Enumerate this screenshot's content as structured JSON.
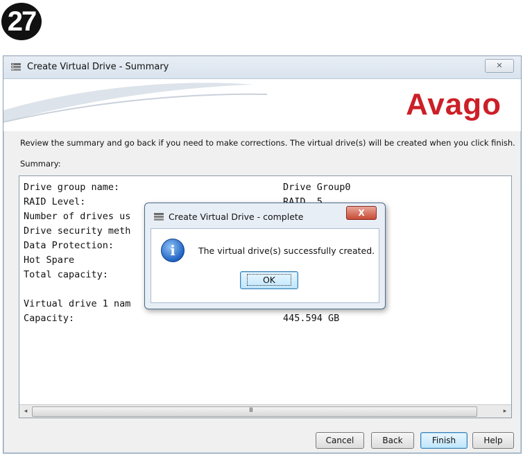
{
  "step_number": "27",
  "window": {
    "title": "Create Virtual Drive - Summary",
    "close_glyph": "✕"
  },
  "brand": {
    "logo_text": "Avago",
    "logo_color": "#cc1f27"
  },
  "instructions": "Review the summary and go back if you need to make corrections. The virtual drive(s) will be created when you click finish.",
  "summary_label": "Summary:",
  "summary_rows": [
    {
      "label": "Drive group name:",
      "value": "Drive Group0"
    },
    {
      "label": "RAID Level:",
      "value": "RAID  5"
    },
    {
      "label": "Number of drives us",
      "value": ""
    },
    {
      "label": "Drive security meth",
      "value": ""
    },
    {
      "label": "Data Protection:",
      "value": ""
    },
    {
      "label": "Hot Spare",
      "value": ""
    },
    {
      "label": "Total capacity:",
      "value": ""
    },
    {
      "label": "Virtual drive 1 nam",
      "value": ""
    },
    {
      "label": "Capacity:",
      "value": "445.594 GB"
    }
  ],
  "scrollbar": {
    "grip": "III",
    "left_arrow": "◂",
    "right_arrow": "▸"
  },
  "buttons": {
    "cancel": "Cancel",
    "back": "Back",
    "finish": "Finish",
    "help": "Help"
  },
  "dialog": {
    "title": "Create Virtual Drive - complete",
    "close_glyph": "X",
    "icon_glyph": "i",
    "message": "The virtual drive(s) successfully created.",
    "ok_label": "OK"
  }
}
